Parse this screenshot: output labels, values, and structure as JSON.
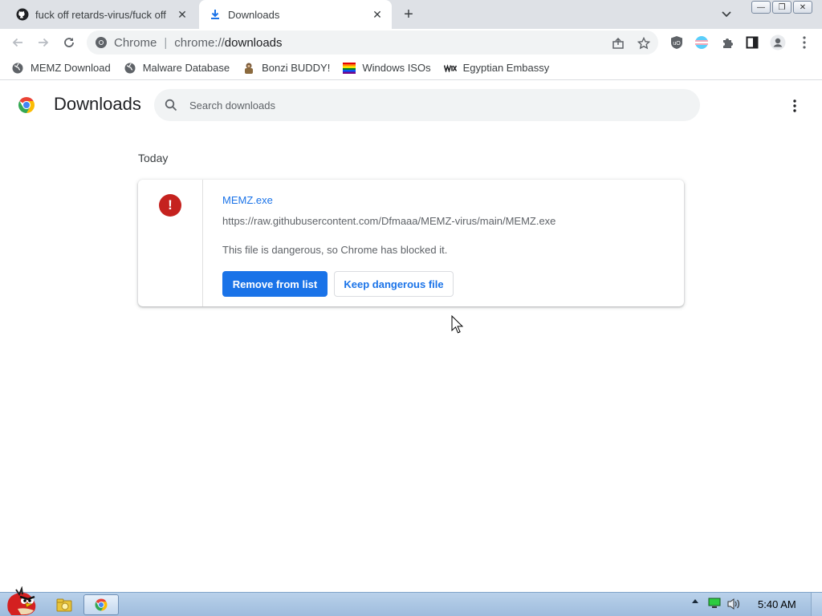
{
  "tabs": [
    {
      "title": "fuck off retards-virus/fuck off",
      "icon": "github-icon",
      "active": false
    },
    {
      "title": "Downloads",
      "icon": "download-icon",
      "active": true
    }
  ],
  "window_buttons": {
    "minimize": "—",
    "restore": "❐",
    "close": "✕"
  },
  "omnibox": {
    "site_label": "Chrome",
    "separator": "|",
    "url_scheme": "chrome://",
    "url_host": "downloads"
  },
  "bookmarks": [
    {
      "label": "MEMZ Download",
      "icon": "globe-icon"
    },
    {
      "label": "Malware Database",
      "icon": "globe-icon"
    },
    {
      "label": "Bonzi BUDDY!",
      "icon": "bonzi-icon"
    },
    {
      "label": "Windows ISOs",
      "icon": "rainbow-flag-icon"
    },
    {
      "label": "Egyptian Embassy",
      "icon": "wix-icon"
    }
  ],
  "page": {
    "title": "Downloads",
    "search_placeholder": "Search downloads",
    "section_date": "Today"
  },
  "download": {
    "file_name": "MEMZ.exe",
    "url": "https://raw.githubusercontent.com/Dfmaaa/MEMZ-virus/main/MEMZ.exe",
    "status": "This file is dangerous, so Chrome has blocked it.",
    "danger_symbol": "!",
    "remove_label": "Remove from list",
    "keep_label": "Keep dangerous file"
  },
  "taskbar": {
    "clock": "5:40 AM"
  },
  "colors": {
    "accent": "#1a73e8",
    "danger": "#c5221f",
    "tabstrip": "#dee1e6",
    "omnibox": "#f1f3f4"
  }
}
